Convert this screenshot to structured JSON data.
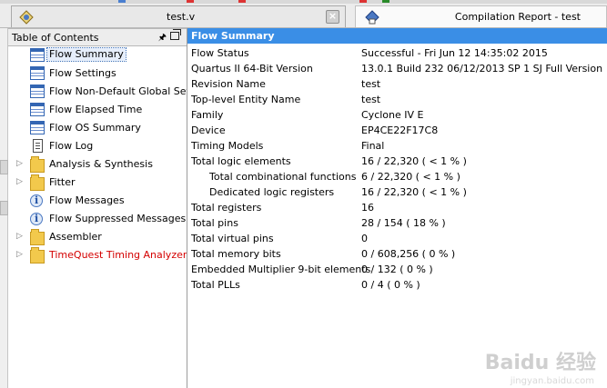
{
  "tabs": [
    {
      "label": "test.v",
      "icon": "verilog-file-icon",
      "close": "×"
    },
    {
      "label": "Compilation Report - test",
      "icon": "compilation-report-icon"
    }
  ],
  "toc": {
    "title": "Table of Contents",
    "pin": "🖈",
    "items": [
      {
        "label": "Flow Summary",
        "icon": "table-icon",
        "selected": true
      },
      {
        "label": "Flow Settings",
        "icon": "table-icon"
      },
      {
        "label": "Flow Non-Default Global Settings",
        "icon": "table-icon"
      },
      {
        "label": "Flow Elapsed Time",
        "icon": "table-icon"
      },
      {
        "label": "Flow OS Summary",
        "icon": "table-icon"
      },
      {
        "label": "Flow Log",
        "icon": "document-icon"
      },
      {
        "label": "Analysis & Synthesis",
        "icon": "folder-icon",
        "expander": "▷"
      },
      {
        "label": "Fitter",
        "icon": "folder-icon",
        "expander": "▷"
      },
      {
        "label": "Flow Messages",
        "icon": "info-icon"
      },
      {
        "label": "Flow Suppressed Messages",
        "icon": "info-icon"
      },
      {
        "label": "Assembler",
        "icon": "folder-icon",
        "expander": "▷"
      },
      {
        "label": "TimeQuest Timing Analyzer",
        "icon": "folder-icon",
        "expander": "▷",
        "color": "#d40000"
      }
    ]
  },
  "summary": {
    "title": "Flow Summary",
    "rows": [
      {
        "key": "Flow Status",
        "value": "Successful - Fri Jun 12 14:35:02 2015"
      },
      {
        "key": "Quartus II 64-Bit Version",
        "value": "13.0.1 Build 232 06/12/2013 SP 1 SJ Full Version"
      },
      {
        "key": "Revision Name",
        "value": "test"
      },
      {
        "key": "Top-level Entity Name",
        "value": "test"
      },
      {
        "key": "Family",
        "value": "Cyclone IV E"
      },
      {
        "key": "Device",
        "value": "EP4CE22F17C8"
      },
      {
        "key": "Timing Models",
        "value": "Final"
      },
      {
        "key": "Total logic elements",
        "value": "16 / 22,320 ( < 1 % )"
      },
      {
        "key": "Total combinational functions",
        "value": "6 / 22,320 ( < 1 % )",
        "sub": true
      },
      {
        "key": "Dedicated logic registers",
        "value": "16 / 22,320 ( < 1 % )",
        "sub": true
      },
      {
        "key": "Total registers",
        "value": "16"
      },
      {
        "key": "Total pins",
        "value": "28 / 154 ( 18 % )"
      },
      {
        "key": "Total virtual pins",
        "value": "0"
      },
      {
        "key": "Total memory bits",
        "value": "0 / 608,256 ( 0 % )"
      },
      {
        "key": "Embedded Multiplier 9-bit elements",
        "value": "0 / 132 ( 0 % )"
      },
      {
        "key": "Total PLLs",
        "value": "0 / 4 ( 0 % )"
      }
    ]
  },
  "watermark": {
    "text": "Baidu 经验",
    "sub": "jingyan.baidu.com"
  },
  "colors": {
    "header_blue": "#3a8ee6",
    "selection": "#e6eefb",
    "red_item": "#d40000"
  }
}
